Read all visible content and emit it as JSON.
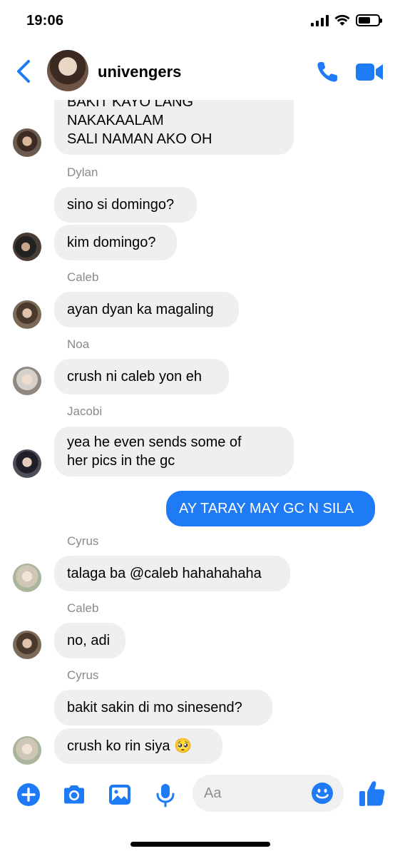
{
  "status_bar": {
    "time": "19:06"
  },
  "header": {
    "title": "univengers"
  },
  "messages": [
    {
      "type": "in",
      "sender": "",
      "text": "BAKIT KAYO LANG\nNAKAKAALAM\nSALI NAMAN AKO OH"
    },
    {
      "type": "in",
      "sender": "Dylan",
      "text": "sino si domingo?"
    },
    {
      "type": "in",
      "sender": "",
      "text": "kim domingo?"
    },
    {
      "type": "in",
      "sender": "Caleb",
      "text": "ayan dyan ka magaling"
    },
    {
      "type": "in",
      "sender": "Noa",
      "text": "crush ni caleb yon eh"
    },
    {
      "type": "in",
      "sender": "Jacobi",
      "text": "yea he even sends some of\nher pics in the gc"
    },
    {
      "type": "out",
      "sender": "",
      "text": "AY TARAY MAY GC N SILA"
    },
    {
      "type": "in",
      "sender": "Cyrus",
      "text": "talaga ba @caleb hahahahaha"
    },
    {
      "type": "in",
      "sender": "Caleb",
      "text": "no, adi"
    },
    {
      "type": "in",
      "sender": "Cyrus",
      "text": "bakit sakin di mo sinesend?"
    },
    {
      "type": "in",
      "sender": "",
      "text": "crush ko rin siya 🥺"
    }
  ],
  "composer": {
    "placeholder": "Aa"
  },
  "colors": {
    "accent": "#1f7af5",
    "incoming_bubble": "#efefef",
    "sender_label": "#8a8a8e"
  },
  "icons": [
    "back-chevron-icon",
    "phone-icon",
    "video-camera-icon",
    "plus-icon",
    "camera-icon",
    "photo-icon",
    "microphone-icon",
    "emoji-icon",
    "thumbs-up-icon"
  ]
}
